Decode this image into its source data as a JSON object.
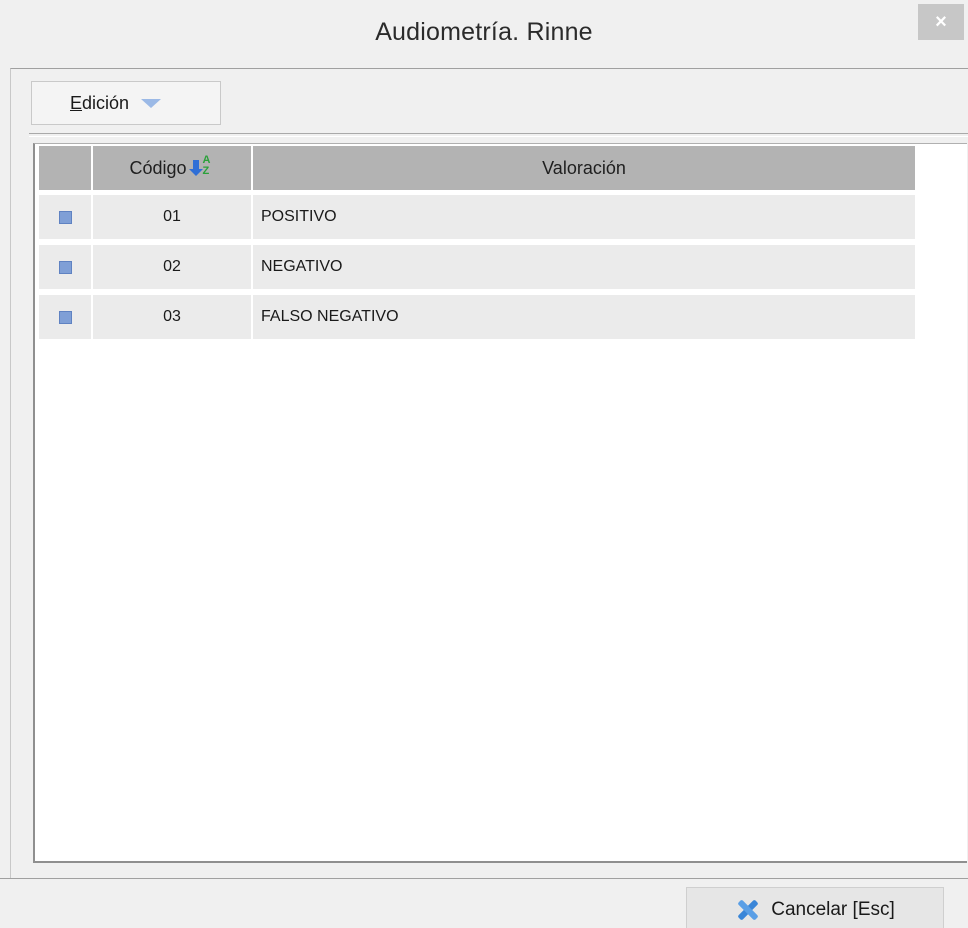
{
  "window": {
    "title": "Audiometría. Rinne",
    "close_glyph": "×"
  },
  "toolbar": {
    "edit_menu": {
      "accesskey": "E",
      "label_rest": "dición",
      "icon": "chevron-down-icon"
    }
  },
  "grid": {
    "columns": [
      {
        "label": "Código",
        "sort_icon": "sort-az-icon"
      },
      {
        "label": "Valoración"
      }
    ],
    "rows": [
      {
        "code": "01",
        "value": "POSITIVO"
      },
      {
        "code": "02",
        "value": "NEGATIVO"
      },
      {
        "code": "03",
        "value": "FALSO NEGATIVO"
      }
    ]
  },
  "footer": {
    "cancel_label": "Cancelar [Esc]",
    "cancel_icon": "close-x-icon"
  },
  "colors": {
    "header_bg": "#b3b3b3",
    "row_bg": "#ebebeb",
    "indicator": "#7f9fd6",
    "accent": "#3a86d8"
  }
}
